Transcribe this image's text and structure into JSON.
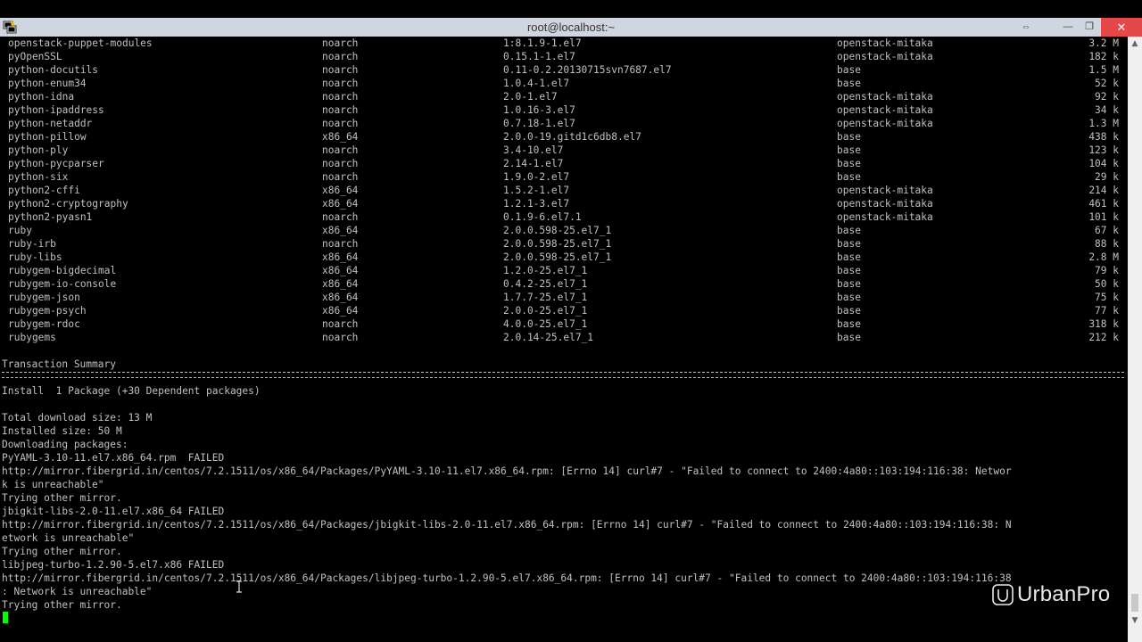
{
  "window": {
    "title": "root@localhost:~",
    "icon": "putty-icon",
    "resize_glyph": "⇔",
    "minimize_glyph": "—",
    "restore_glyph": "❐",
    "close_glyph": "✕",
    "close_color": "#e54848"
  },
  "packages": {
    "rows": [
      {
        "name": "openstack-puppet-modules",
        "arch": "noarch",
        "version": "1:8.1.9-1.el7",
        "repo": "openstack-mitaka",
        "size": "3.2 M"
      },
      {
        "name": "pyOpenSSL",
        "arch": "noarch",
        "version": "0.15.1-1.el7",
        "repo": "openstack-mitaka",
        "size": "182 k"
      },
      {
        "name": "python-docutils",
        "arch": "noarch",
        "version": "0.11-0.2.20130715svn7687.el7",
        "repo": "base",
        "size": "1.5 M"
      },
      {
        "name": "python-enum34",
        "arch": "noarch",
        "version": "1.0.4-1.el7",
        "repo": "base",
        "size": "52 k"
      },
      {
        "name": "python-idna",
        "arch": "noarch",
        "version": "2.0-1.el7",
        "repo": "openstack-mitaka",
        "size": "92 k"
      },
      {
        "name": "python-ipaddress",
        "arch": "noarch",
        "version": "1.0.16-3.el7",
        "repo": "openstack-mitaka",
        "size": "34 k"
      },
      {
        "name": "python-netaddr",
        "arch": "noarch",
        "version": "0.7.18-1.el7",
        "repo": "openstack-mitaka",
        "size": "1.3 M"
      },
      {
        "name": "python-pillow",
        "arch": "x86_64",
        "version": "2.0.0-19.gitd1c6db8.el7",
        "repo": "base",
        "size": "438 k"
      },
      {
        "name": "python-ply",
        "arch": "noarch",
        "version": "3.4-10.el7",
        "repo": "base",
        "size": "123 k"
      },
      {
        "name": "python-pycparser",
        "arch": "noarch",
        "version": "2.14-1.el7",
        "repo": "base",
        "size": "104 k"
      },
      {
        "name": "python-six",
        "arch": "noarch",
        "version": "1.9.0-2.el7",
        "repo": "base",
        "size": "29 k"
      },
      {
        "name": "python2-cffi",
        "arch": "x86_64",
        "version": "1.5.2-1.el7",
        "repo": "openstack-mitaka",
        "size": "214 k"
      },
      {
        "name": "python2-cryptography",
        "arch": "x86_64",
        "version": "1.2.1-3.el7",
        "repo": "openstack-mitaka",
        "size": "461 k"
      },
      {
        "name": "python2-pyasn1",
        "arch": "noarch",
        "version": "0.1.9-6.el7.1",
        "repo": "openstack-mitaka",
        "size": "101 k"
      },
      {
        "name": "ruby",
        "arch": "x86_64",
        "version": "2.0.0.598-25.el7_1",
        "repo": "base",
        "size": "67 k"
      },
      {
        "name": "ruby-irb",
        "arch": "noarch",
        "version": "2.0.0.598-25.el7_1",
        "repo": "base",
        "size": "88 k"
      },
      {
        "name": "ruby-libs",
        "arch": "x86_64",
        "version": "2.0.0.598-25.el7_1",
        "repo": "base",
        "size": "2.8 M"
      },
      {
        "name": "rubygem-bigdecimal",
        "arch": "x86_64",
        "version": "1.2.0-25.el7_1",
        "repo": "base",
        "size": "79 k"
      },
      {
        "name": "rubygem-io-console",
        "arch": "x86_64",
        "version": "0.4.2-25.el7_1",
        "repo": "base",
        "size": "50 k"
      },
      {
        "name": "rubygem-json",
        "arch": "x86_64",
        "version": "1.7.7-25.el7_1",
        "repo": "base",
        "size": "75 k"
      },
      {
        "name": "rubygem-psych",
        "arch": "x86_64",
        "version": "2.0.0-25.el7_1",
        "repo": "base",
        "size": "77 k"
      },
      {
        "name": "rubygem-rdoc",
        "arch": "noarch",
        "version": "4.0.0-25.el7_1",
        "repo": "base",
        "size": "318 k"
      },
      {
        "name": "rubygems",
        "arch": "noarch",
        "version": "2.0.14-25.el7_1",
        "repo": "base",
        "size": "212 k"
      }
    ]
  },
  "summary": {
    "heading": "Transaction Summary",
    "install": "Install  1 Package (+30 Dependent packages)"
  },
  "log": [
    "Total download size: 13 M",
    "Installed size: 50 M",
    "Downloading packages:",
    "PyYAML-3.10-11.el7.x86_64.rpm  FAILED",
    "http://mirror.fibergrid.in/centos/7.2.1511/os/x86_64/Packages/PyYAML-3.10-11.el7.x86_64.rpm: [Errno 14] curl#7 - \"Failed to connect to 2400:4a80::103:194:116:38: Networ",
    "k is unreachable\"",
    "Trying other mirror.",
    "jbigkit-libs-2.0-11.el7.x86_64 FAILED",
    "http://mirror.fibergrid.in/centos/7.2.1511/os/x86_64/Packages/jbigkit-libs-2.0-11.el7.x86_64.rpm: [Errno 14] curl#7 - \"Failed to connect to 2400:4a80::103:194:116:38: N",
    "etwork is unreachable\"",
    "Trying other mirror.",
    "libjpeg-turbo-1.2.90-5.el7.x86 FAILED",
    "http://mirror.fibergrid.in/centos/7.2.1511/os/x86_64/Packages/libjpeg-turbo-1.2.90-5.el7.x86_64.rpm: [Errno 14] curl#7 - \"Failed to connect to 2400:4a80::103:194:116:38",
    ": Network is unreachable\"",
    "Trying other mirror."
  ],
  "terminal": {
    "cursor_color": "#00ff00"
  },
  "watermark": {
    "text": "UrbanPro",
    "icon": "urbanpro-logo-icon"
  },
  "scrollbar": {
    "up_glyph": "▲",
    "down_glyph": "▼"
  }
}
